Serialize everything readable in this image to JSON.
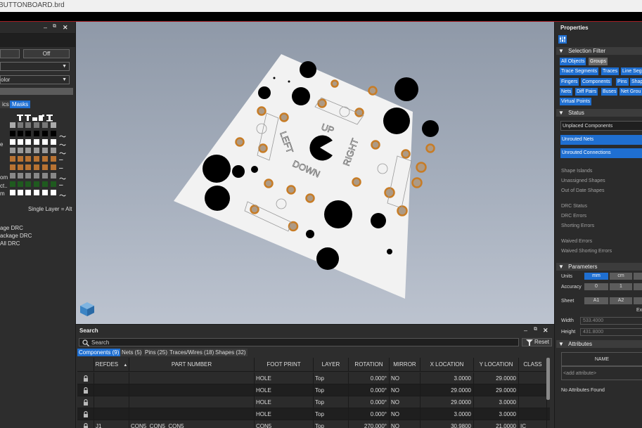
{
  "window": {
    "title": "BUTTONBOARD.brd"
  },
  "left_panel": {
    "toggle_label": "Off",
    "select2_value": "olor",
    "tabs": [
      {
        "label": "ics"
      },
      {
        "label": "Masks"
      }
    ],
    "row_labels": [
      "",
      "",
      "e",
      "",
      "",
      "",
      "om",
      "ct..",
      "m"
    ],
    "single_layer": "Single Layer = Alt",
    "drc": [
      "age DRC",
      "ackage DRC",
      "All DRC"
    ]
  },
  "canvas": {
    "silkscreen": [
      "UP",
      "LEFT",
      "RIGHT",
      "DOWN"
    ]
  },
  "search_panel": {
    "title": "Search",
    "search_placeholder": "Search",
    "reset_label": "Reset",
    "tabs": [
      {
        "label": "Components (9)"
      },
      {
        "label": "Nets (5)"
      },
      {
        "label": "Pins (25)"
      },
      {
        "label": "Traces/Wires (18)"
      },
      {
        "label": "Shapes (32)"
      }
    ],
    "columns": [
      "REFDES",
      "PART NUMBER",
      "FOOT PRINT",
      "LAYER",
      "ROTATION",
      "MIRROR",
      "X LOCATION",
      "Y LOCATION",
      "CLASS"
    ],
    "rows": [
      {
        "refdes": "",
        "part": "",
        "foot": "HOLE",
        "layer": "Top",
        "rotation": "0.000°",
        "mirror": "NO",
        "x": "3.0000",
        "y": "29.0000",
        "class": ""
      },
      {
        "refdes": "",
        "part": "",
        "foot": "HOLE",
        "layer": "Top",
        "rotation": "0.000°",
        "mirror": "NO",
        "x": "29.0000",
        "y": "29.0000",
        "class": ""
      },
      {
        "refdes": "",
        "part": "",
        "foot": "HOLE",
        "layer": "Top",
        "rotation": "0.000°",
        "mirror": "NO",
        "x": "29.0000",
        "y": "3.0000",
        "class": ""
      },
      {
        "refdes": "",
        "part": "",
        "foot": "HOLE",
        "layer": "Top",
        "rotation": "0.000°",
        "mirror": "NO",
        "x": "3.0000",
        "y": "3.0000",
        "class": ""
      },
      {
        "refdes": "J1",
        "part": "CON5_CON5_CON5",
        "foot": "CON5",
        "layer": "Top",
        "rotation": "270.000°",
        "mirror": "NO",
        "x": "30.9800",
        "y": "21.0000",
        "class": "IC"
      }
    ]
  },
  "properties": {
    "title": "Properties",
    "selection_filter": {
      "title": "Selection Filter",
      "chips": [
        "All Objects",
        "Groups",
        "Trace Segments",
        "Traces",
        "Line Seg",
        "Fingers",
        "Components",
        "Pins",
        "Shap",
        "Nets",
        "Diff Pairs",
        "Buses",
        "Net Grou",
        "Virtual Points"
      ]
    },
    "status": {
      "title": "Status",
      "rows": [
        "Unplaced Components",
        "Unrouted Nets",
        "Unrouted Connections"
      ],
      "items": [
        "Shape Islands",
        "Unassigned Shapes",
        "Out of Date Shapes",
        "DRC Status",
        "DRC Errors",
        "Shorting Errors",
        "Waived Errors",
        "Waived Shorting Errors"
      ]
    },
    "parameters": {
      "title": "Parameters",
      "units_label": "Units",
      "units": [
        "mm",
        "cm"
      ],
      "accuracy_label": "Accuracy",
      "accuracy": [
        "0",
        "1"
      ],
      "sheet_label": "Sheet",
      "sheet": [
        "A1",
        "A2"
      ],
      "ex_label": "Ex",
      "width_label": "Width",
      "width_value": "533.4000",
      "height_label": "Height",
      "height_value": "431.8000"
    },
    "attributes": {
      "title": "Attributes",
      "name_header": "NAME",
      "add_placeholder": "<add attribute>",
      "empty": "No Attributes Found"
    }
  }
}
